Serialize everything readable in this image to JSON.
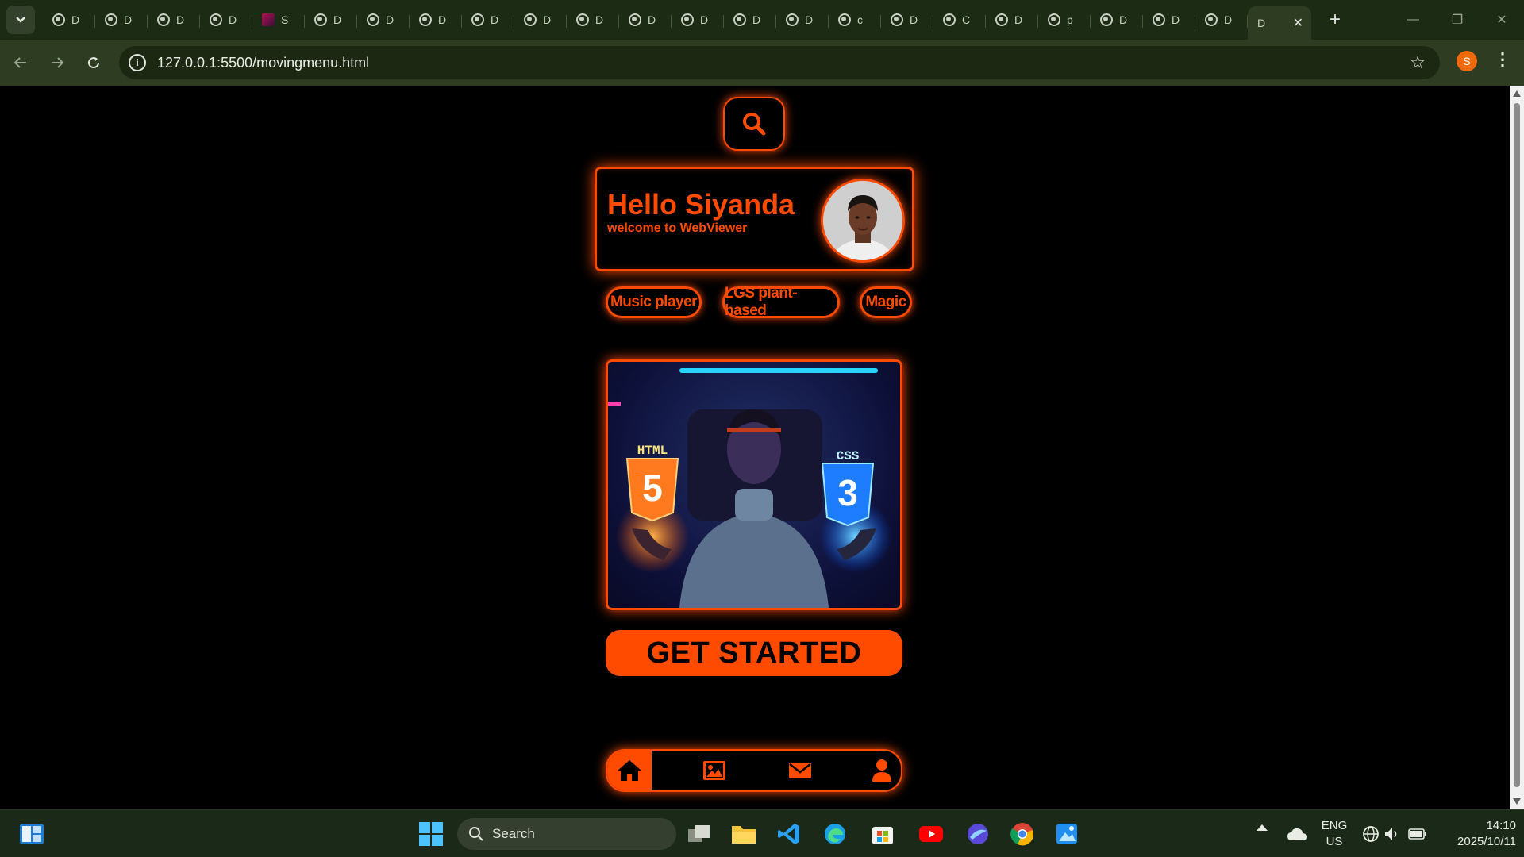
{
  "browser": {
    "tabs": [
      {
        "letter": "D"
      },
      {
        "letter": "D"
      },
      {
        "letter": "D"
      },
      {
        "letter": "D"
      },
      {
        "letter": "S",
        "favicon": "red"
      },
      {
        "letter": "D"
      },
      {
        "letter": "D"
      },
      {
        "letter": "D"
      },
      {
        "letter": "D"
      },
      {
        "letter": "D"
      },
      {
        "letter": "D"
      },
      {
        "letter": "D"
      },
      {
        "letter": "D"
      },
      {
        "letter": "D"
      },
      {
        "letter": "D"
      },
      {
        "letter": "c"
      },
      {
        "letter": "D"
      },
      {
        "letter": "C"
      },
      {
        "letter": "D"
      },
      {
        "letter": "p"
      },
      {
        "letter": "D"
      },
      {
        "letter": "D"
      },
      {
        "letter": "D"
      }
    ],
    "active_tab_letter": "D",
    "url": "127.0.0.1:5500/movingmenu.html",
    "profile_initial": "S"
  },
  "page": {
    "greeting": "Hello Siyanda",
    "subtitle": "welcome to WebViewer",
    "chips": [
      "Music player",
      "LGS plant-based",
      "Magic"
    ],
    "hero_badges": {
      "left": "HTML",
      "left_num": "5",
      "right": "CSS",
      "right_num": "3"
    },
    "cta_label": "GET STARTED",
    "accent": "#ff4b00"
  },
  "taskbar": {
    "search_label": "Search",
    "lang_top": "ENG",
    "lang_bottom": "US",
    "time": "14:10",
    "date": "2025/10/11"
  }
}
